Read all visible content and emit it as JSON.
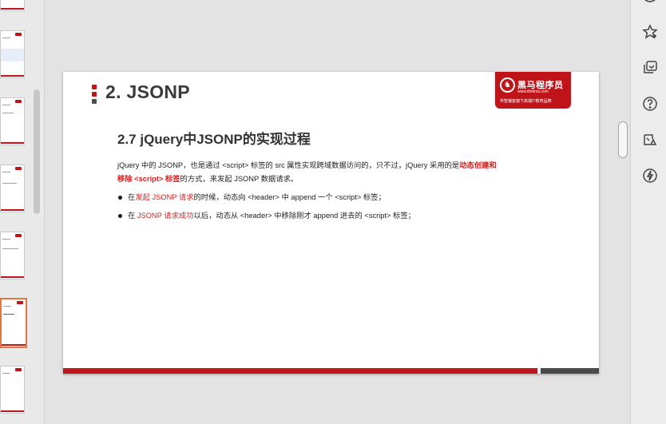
{
  "slide": {
    "section_title": "2. JSONP",
    "subtitle": "2.7 jQuery中JSONP的实现过程",
    "para_part1": "jQuery 中的 JSONP，也是通过 <script> 标签的 src 属性实现跨域数据访问的，只不过，jQuery 采用的是",
    "para_emph1": "动态创建和",
    "para_emph2": "移除 <script> 标签",
    "para_part2": "的方式，来发起 JSONP 数据请求。",
    "bullet1_pre": "在",
    "bullet1_red": "发起 JSONP 请求",
    "bullet1_post": "的时候，动态向 <header> 中 append 一个 <script> 标签；",
    "bullet2_pre": "在 ",
    "bullet2_red": "JSONP 请求成功",
    "bullet2_post": "以后，动态从 <header> 中移除刚才 append 进去的 <script> 标签；",
    "logo_name": "黑马程序员",
    "logo_url": "www.itheima.com",
    "logo_slogan": "传智播客旗下高端IT教育品牌"
  },
  "thumbnails": [
    {
      "active": false
    },
    {
      "active": false
    },
    {
      "active": false
    },
    {
      "active": false
    },
    {
      "active": false
    },
    {
      "active": true
    },
    {
      "active": false
    }
  ],
  "rail_icons": [
    "copilot-icon",
    "favorites-icon",
    "collections-icon",
    "help-icon",
    "performance-icon",
    "bolt-icon"
  ],
  "colors": {
    "accent": "#c0141b",
    "highlight": "#e21b1b",
    "active_thumb": "#e8743b"
  }
}
